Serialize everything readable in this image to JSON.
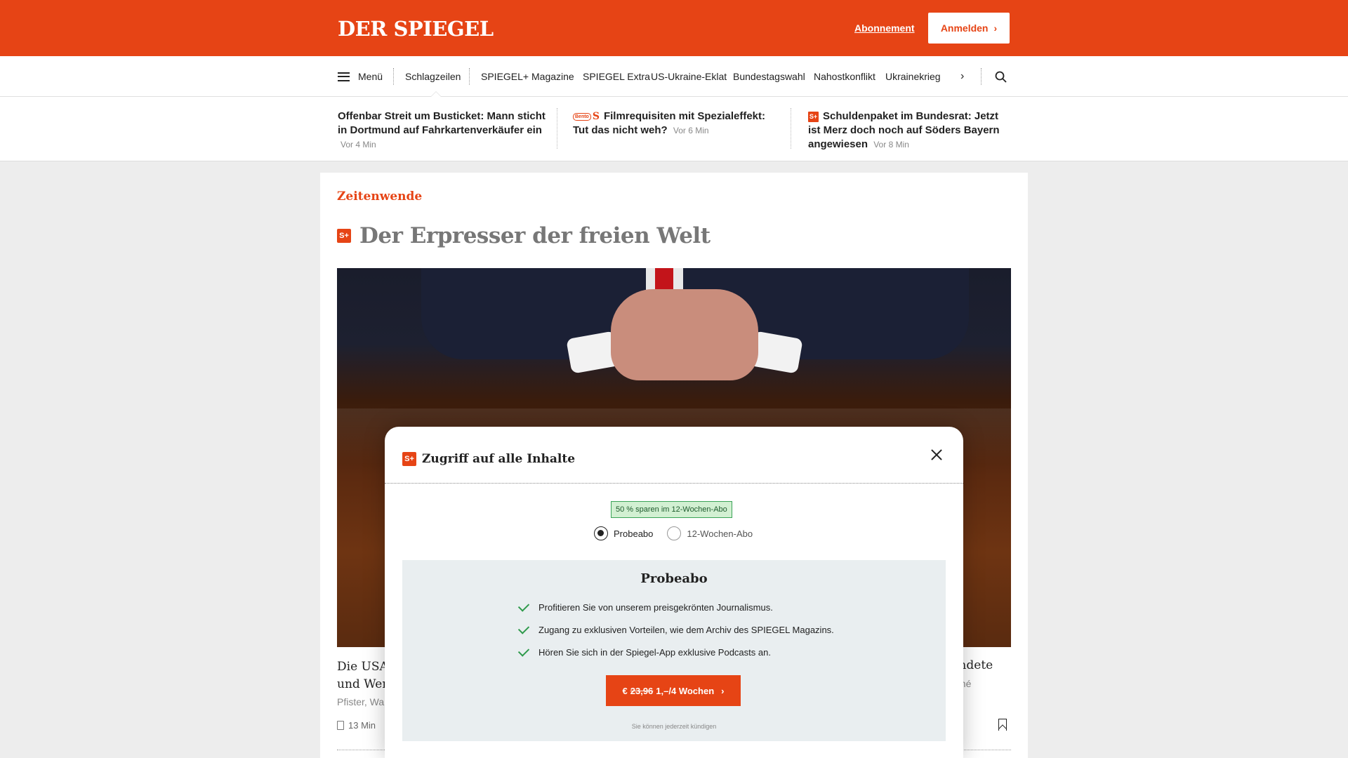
{
  "header": {
    "logo": "DER SPIEGEL",
    "subscription_link": "Abonnement",
    "login_button": "Anmelden"
  },
  "nav": {
    "menu_label": "Menü",
    "items": [
      "Schlagzeilen",
      "SPIEGEL+",
      "Magazine",
      "SPIEGEL Extra",
      "US-Ukraine-Eklat",
      "Bundestagswahl",
      "Nahostkonflikt",
      "Ukrainekrieg"
    ],
    "more_icon": "chevron-right-icon",
    "search_icon": "search-icon"
  },
  "headlines": [
    {
      "title": "Offenbar Streit um Busticket: Mann sticht in Dortmund auf Fahrkartenverkäufer ein",
      "time": "Vor 4 Min"
    },
    {
      "title": "Filmrequisiten mit Spezialeffekt: Tut das nicht weh?",
      "time": "Vor 6 Min",
      "badge": "Bento",
      "badge_s": "S"
    },
    {
      "title": "Schuldenpaket im Bundesrat: Jetzt ist Merz doch noch auf Söders Bayern angewiesen",
      "time": "Vor 8 Min",
      "badge": "S+"
    }
  ],
  "article": {
    "kicker": "Zeitenwende",
    "badge": "S+",
    "title": "Der Erpresser der freien Welt",
    "teaser_left": "Die USA\nund Wer",
    "author": "Pfister, Wa",
    "read_time": "13 Min",
    "teaser_right": "indete",
    "teaser_right_author": "ené"
  },
  "modal": {
    "badge": "S+",
    "title": "Zugriff auf alle Inhalte",
    "save_badge": "50 % sparen im 12-Wochen-Abo",
    "options": [
      "Probeabo",
      "12-Wochen-Abo"
    ],
    "selected_option": "Probeabo",
    "plan_title": "Probeabo",
    "benefits": [
      "Profitieren Sie von unserem preisgekrönten Journalismus.",
      "Zugang zu exklusiven Vorteilen, wie dem Archiv des SPIEGEL Magazins.",
      "Hören Sie sich in der Spiegel-App exklusive Podcasts an."
    ],
    "cta_currency": "€",
    "cta_old_price": "23,96",
    "cta_new_price": "1,–/4 Wochen",
    "cancel_note": "Sie können jederzeit kündigen"
  },
  "colors": {
    "brand": "#e64415",
    "check": "#2e9a4b",
    "badge_bg": "#d2f0d2"
  }
}
